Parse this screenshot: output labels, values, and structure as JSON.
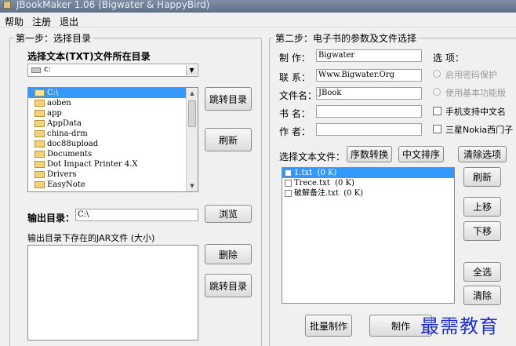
{
  "window": {
    "title": "JBookMaker 1.06 (Bigwater & HappyBird)"
  },
  "menu": {
    "items": [
      "帮助",
      "注册",
      "退出"
    ]
  },
  "step1": {
    "legend": "第一步：选择目录",
    "select_dir_label": "选择文本(TXT)文件所在目录",
    "drive_value": "c:",
    "directories": [
      "C:\\",
      "aoben",
      "app",
      "AppData",
      "china-drm",
      "doc88upload",
      "Documents",
      "Dot Impact Printer 4.X",
      "Drivers",
      "EasyNote"
    ],
    "selected_directory_index": 0,
    "jump_dir_button": "跳转目录",
    "refresh_button": "刷新",
    "output_dir_label": "输出目录：",
    "output_dir_value": "C:\\",
    "browse_button": "浏览",
    "jar_list_label": "输出目录下存在的JAR文件 (大小)",
    "delete_button": "删除",
    "jump_dir_button2": "跳转目录"
  },
  "step2": {
    "legend": "第二步：电子书的参数及文件选择",
    "fields": {
      "maker_label": "制 作：",
      "maker_value": "Bigwater",
      "contact_label": "联 系：",
      "contact_value": "Www.Bigwater.Org",
      "filename_label": "文件名：",
      "filename_value": "JBook",
      "bookname_label": "书 名：",
      "bookname_value": "",
      "author_label": "作 者：",
      "author_value": ""
    },
    "options": {
      "label": "选 项：",
      "password_protect": "启用密码保护",
      "basic_functions": "使用基本功能版",
      "chinese_support": "手机支持中文名",
      "samsung_nokia": "三星Nokia西门子"
    },
    "select_text_files_label": "选择文本文件：",
    "number_sort_button": "序数转换",
    "chinese_sort_button": "中文排序",
    "clear_options_button": "清除选项",
    "files": [
      {
        "name": "1.txt",
        "size": "(0 K)"
      },
      {
        "name": "Trece.txt",
        "size": "(0 K)"
      },
      {
        "name": "破解备注.txt",
        "size": "(0 K)"
      }
    ],
    "selected_file_index": 0,
    "refresh_button": "刷新",
    "move_up_button": "上移",
    "move_down_button": "下移",
    "select_all_button": "全选",
    "clear_button": "清除",
    "batch_make_button": "批量制作",
    "make_button": "制作"
  },
  "watermark": "最需教育",
  "colors": {
    "selection": "#3399ff",
    "watermark": "#1f2fc8"
  }
}
